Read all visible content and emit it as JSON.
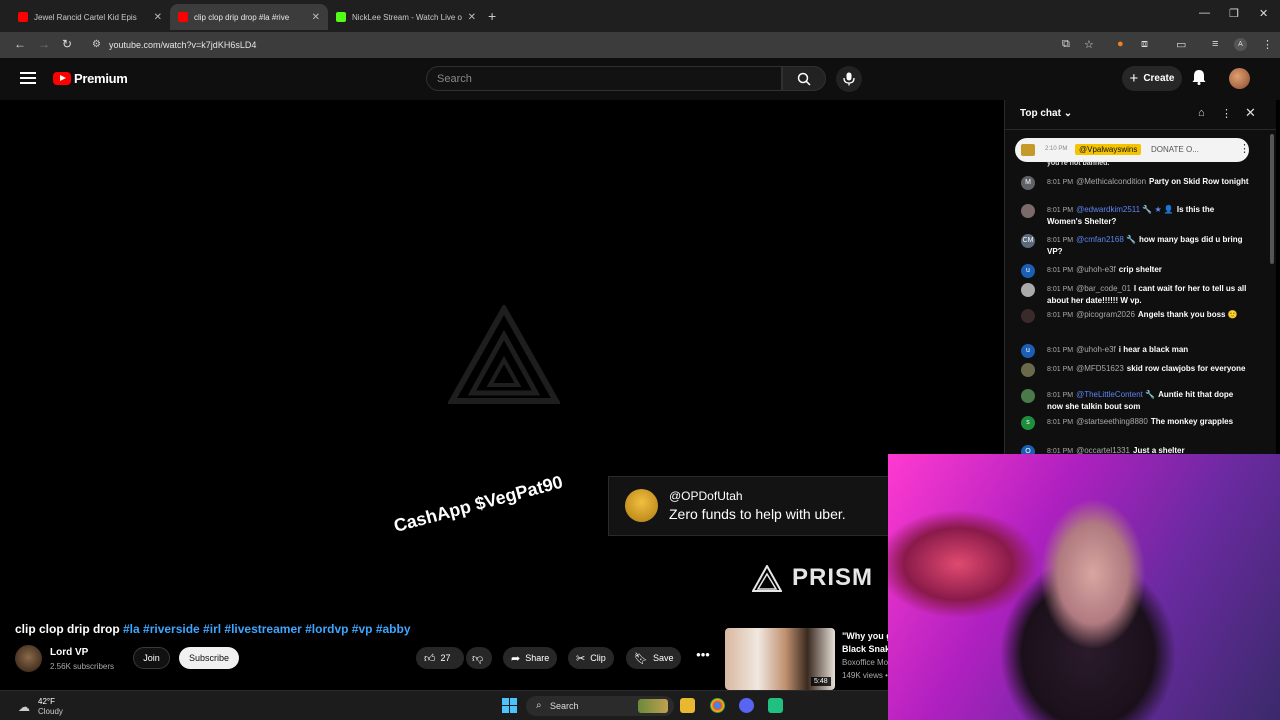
{
  "browser": {
    "tabs": [
      {
        "title": "Jewel Rancid Cartel Kid Epis",
        "active": false
      },
      {
        "title": "clip clop drip drop #la #rive",
        "active": true
      },
      {
        "title": "NickLee Stream - Watch Live o",
        "active": false
      }
    ],
    "url": "youtube.com/watch?v=k7jdKH6sLD4"
  },
  "header": {
    "logo_text": "Premium",
    "search_placeholder": "Search",
    "create_label": "Create"
  },
  "video": {
    "overlay_cashapp": "CashApp $VegPat90",
    "alert_user": "@OPDofUtah",
    "alert_message": "Zero funds to help with uber.",
    "brand": "PRISM",
    "title_main": "clip clop drip drop ",
    "title_tags": "#la #riverside #irl #livestreamer #lordvp #vp #abby",
    "channel_name": "Lord VP",
    "channel_subs": "2.56K subscribers",
    "join_label": "Join",
    "subscribe_label": "Subscribe",
    "likes": "27",
    "share_label": "Share",
    "clip_label": "Clip",
    "save_label": "Save"
  },
  "recommended": {
    "title_line1": "\"Why you g",
    "title_line2": "Black Snak",
    "channel": "Boxoffice Mo",
    "views": "149K views •",
    "duration": "5:48"
  },
  "chat": {
    "header_label": "Top chat",
    "pinned": {
      "time": "2:10 PM",
      "user": "@Vpalwayswins",
      "message": "DONATE O..."
    },
    "cut_text": "you're not banned.",
    "messages": [
      {
        "initial": "M",
        "color": "#5f6368",
        "time": "8:01 PM",
        "user": "@Methicalcondition",
        "text": "Party on Skid Row tonight",
        "blue": false
      },
      {
        "initial": "",
        "color": "#7a6a6a",
        "time": "8:01 PM",
        "user": "@edwardkim2511 🔧 ★ 👤",
        "text": "Is this the Women's Shelter?",
        "blue": true
      },
      {
        "initial": "CM",
        "color": "#5a6a7a",
        "time": "8:01 PM",
        "user": "@cmfan2168 🔧",
        "text": "how many bags did u bring VP?",
        "blue": true
      },
      {
        "initial": "u",
        "color": "#1a5fb4",
        "time": "8:01 PM",
        "user": "@uhoh-e3f",
        "text": "crip shelter",
        "blue": false
      },
      {
        "initial": "",
        "color": "#aaaaaa",
        "time": "8:01 PM",
        "user": "@bar_code_01",
        "text": "I cant wait for her to tell us all about her date!!!!!! W vp.",
        "blue": false
      },
      {
        "initial": "",
        "color": "#3a2a2a",
        "time": "8:01 PM",
        "user": "@picogram2026",
        "text": "Angels thank you boss 🙂",
        "blue": false
      },
      {
        "initial": "u",
        "color": "#1a5fb4",
        "time": "8:01 PM",
        "user": "@uhoh-e3f",
        "text": "i hear a black man",
        "blue": false
      },
      {
        "initial": "",
        "color": "#6a6a4a",
        "time": "8:01 PM",
        "user": "@MFD51623",
        "text": "skid row clawjobs for everyone",
        "blue": false
      },
      {
        "initial": "",
        "color": "#4a7a4a",
        "time": "8:01 PM",
        "user": "@TheLittleContent 🔧",
        "text": "Auntie hit that dope now she talkin bout som",
        "blue": true
      },
      {
        "initial": "s",
        "color": "#1e8e3e",
        "time": "8:01 PM",
        "user": "@startseething8880",
        "text": "The monkey grapples",
        "blue": false
      },
      {
        "initial": "O",
        "color": "#1a5fb4",
        "time": "8:01 PM",
        "user": "@occartel1331",
        "text": "Just a shelter",
        "blue": false
      }
    ]
  },
  "taskbar": {
    "temperature": "42°F",
    "condition": "Cloudy",
    "search_label": "Search"
  }
}
